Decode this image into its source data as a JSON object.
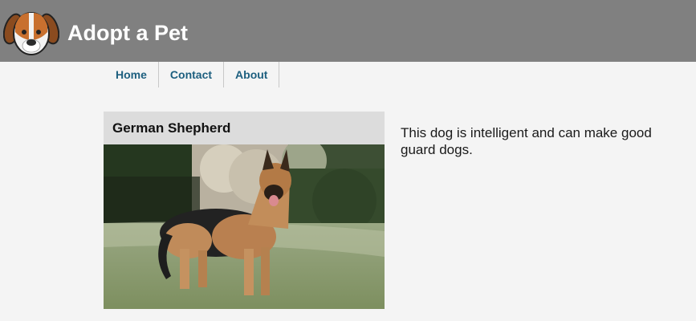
{
  "header": {
    "title": "Adopt a Pet",
    "logo_icon": "dog-face-icon"
  },
  "nav": {
    "items": [
      {
        "label": "Home"
      },
      {
        "label": "Contact"
      },
      {
        "label": "About"
      }
    ]
  },
  "pet": {
    "name": "German Shepherd",
    "description": "This dog is intelligent and can make good guard dogs.",
    "photo_icon": "german-shepherd-photo"
  },
  "colors": {
    "header_bg": "#808080",
    "nav_link": "#1d5f7f",
    "page_bg": "#f4f4f4"
  }
}
